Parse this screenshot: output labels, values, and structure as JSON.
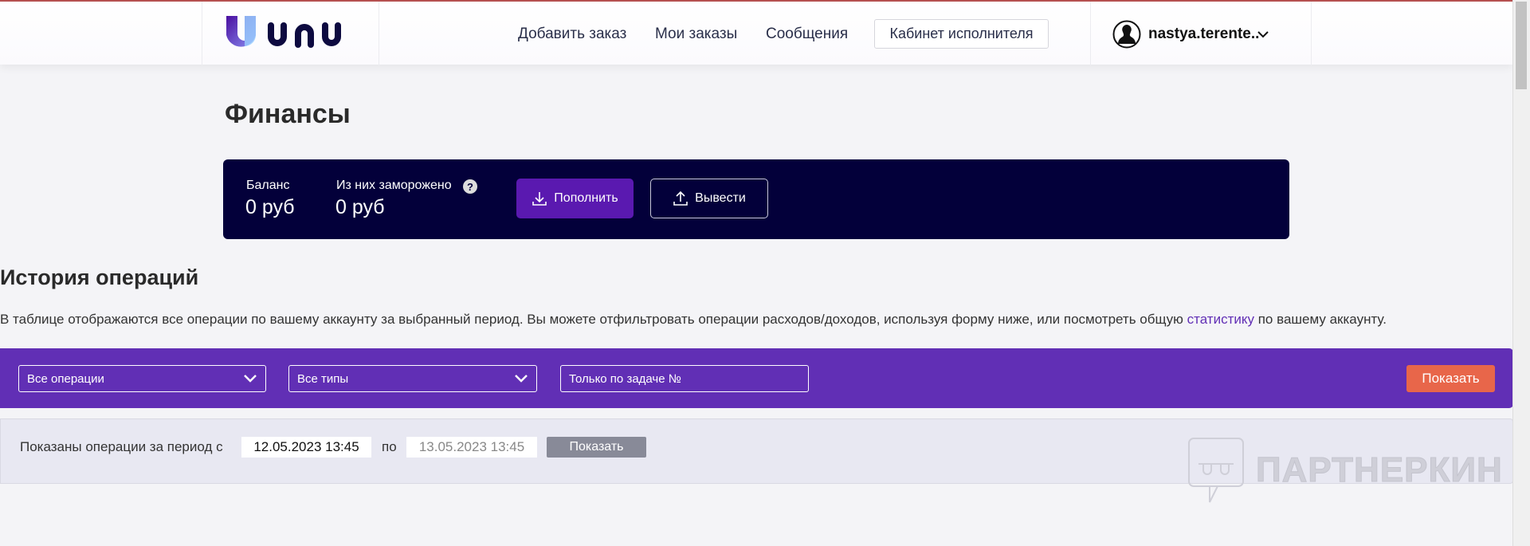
{
  "header": {
    "logo_text": "unu",
    "nav": [
      "Добавить заказ",
      "Мои заказы",
      "Сообщения"
    ],
    "cabinet_label": "Кабинет исполнителя",
    "user_name": "nastya.terente.."
  },
  "page": {
    "title": "Финансы"
  },
  "balance": {
    "balance_label": "Баланс",
    "balance_value": "0 руб",
    "frozen_label": "Из них заморожено",
    "frozen_value": "0 руб",
    "deposit_label": "Пополнить",
    "withdraw_label": "Вывести"
  },
  "history": {
    "title": "История операций",
    "desc_before": "В таблице отображаются все операции по вашему аккаунту за выбранный период. Вы можете отфильтровать операции расходов/доходов, используя форму ниже, или посмотреть общую ",
    "desc_link": "статистику",
    "desc_after": " по вашему аккаунту."
  },
  "filters": {
    "operations": "Все операции",
    "types": "Все типы",
    "task_placeholder": "Только по задаче №",
    "show_label": "Показать"
  },
  "period": {
    "label": "Показаны операции за период с",
    "from": "12.05.2023 13:45",
    "to_label": "по",
    "to": "13.05.2023 13:45",
    "show_label": "Показать"
  },
  "watermark": "ПАРТНЕРКИН",
  "colors": {
    "dark": "#03003a",
    "purple": "#612fb5",
    "accent": "#e8664a",
    "button": "#5a19b0"
  }
}
